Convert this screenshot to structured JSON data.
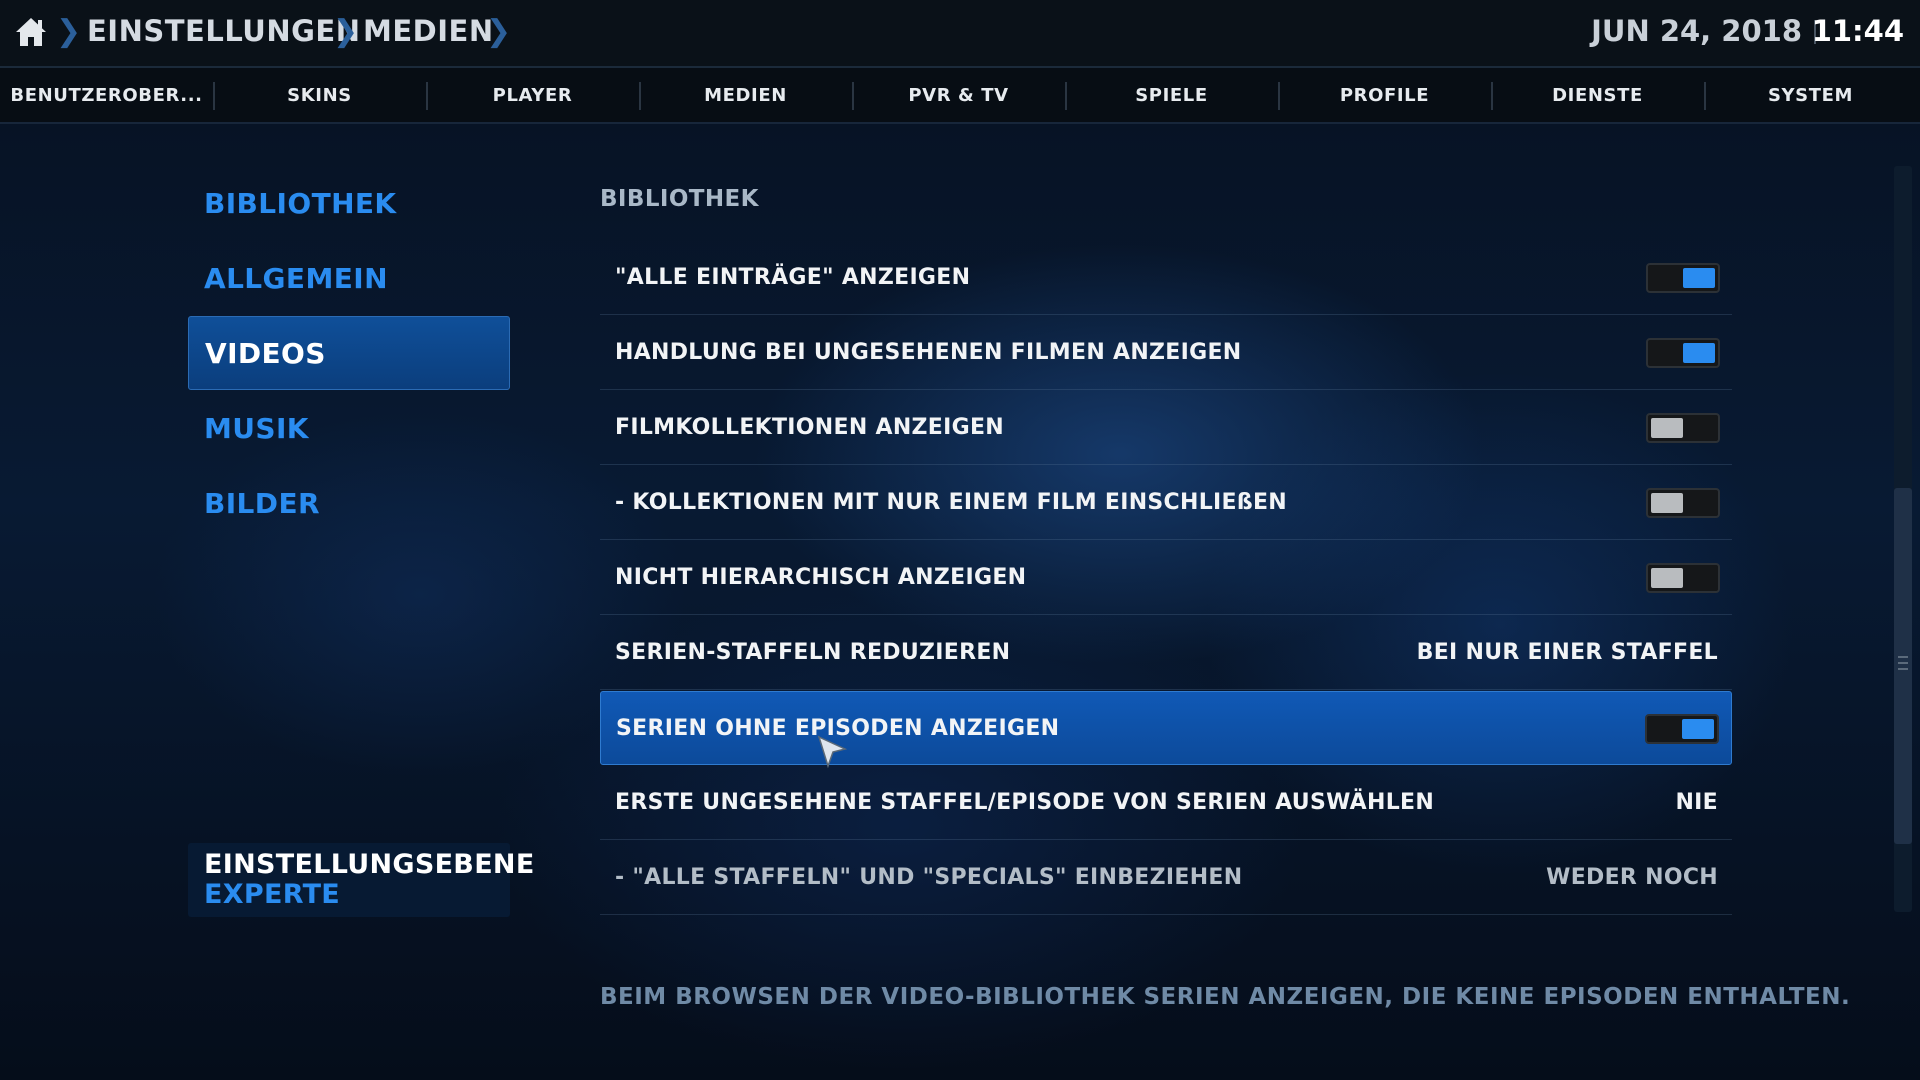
{
  "breadcrumb": [
    "EINSTELLUNGEN",
    "MEDIEN"
  ],
  "header": {
    "date": "JUN 24, 2018",
    "time": "11:44"
  },
  "tabs": [
    "BENUTZEROBER...",
    "SKINS",
    "PLAYER",
    "MEDIEN",
    "PVR & TV",
    "SPIELE",
    "PROFILE",
    "DIENSTE",
    "SYSTEM"
  ],
  "sidebar": {
    "items": [
      {
        "label": "BIBLIOTHEK"
      },
      {
        "label": "ALLGEMEIN"
      },
      {
        "label": "VIDEOS",
        "active": true
      },
      {
        "label": "MUSIK"
      },
      {
        "label": "BILDER"
      }
    ],
    "settings_level": {
      "title": "EINSTELLUNGSEBENE",
      "value": "EXPERTE"
    }
  },
  "section_title": "BIBLIOTHEK",
  "settings": [
    {
      "label": "\"ALLE EINTRÄGE\" ANZEIGEN",
      "type": "toggle",
      "on": true
    },
    {
      "label": "HANDLUNG BEI UNGESEHENEN FILMEN ANZEIGEN",
      "type": "toggle",
      "on": true
    },
    {
      "label": "FILMKOLLEKTIONEN ANZEIGEN",
      "type": "toggle",
      "on": false
    },
    {
      "label": "- KOLLEKTIONEN MIT NUR EINEM FILM EINSCHLIEßEN",
      "type": "toggle",
      "on": false
    },
    {
      "label": "NICHT HIERARCHISCH ANZEIGEN",
      "type": "toggle",
      "on": false
    },
    {
      "label": "SERIEN-STAFFELN REDUZIEREN",
      "type": "value",
      "value": "BEI NUR EINER STAFFEL"
    },
    {
      "label": "SERIEN OHNE EPISODEN ANZEIGEN",
      "type": "toggle",
      "on": true,
      "focused": true
    },
    {
      "label": "ERSTE UNGESEHENE STAFFEL/EPISODE VON SERIEN AUSWÄHLEN",
      "type": "value",
      "value": "NIE"
    },
    {
      "label": "- \"ALLE STAFFELN\" UND \"SPECIALS\" EINBEZIEHEN",
      "type": "value",
      "value": "WEDER NOCH",
      "disabled": true
    }
  ],
  "description": "BEIM BROWSEN DER VIDEO-BIBLIOTHEK SERIEN ANZEIGEN, DIE KEINE EPISODEN ENTHALTEN.",
  "icons": {
    "home": "home-icon",
    "breadcrumb_separator": "chevron-right-icon",
    "cursor": "mouse-pointer-icon"
  },
  "colors": {
    "accent": "#2a8cf0",
    "focus": "#1059b6",
    "toggle_off": "#b9bcbf"
  }
}
